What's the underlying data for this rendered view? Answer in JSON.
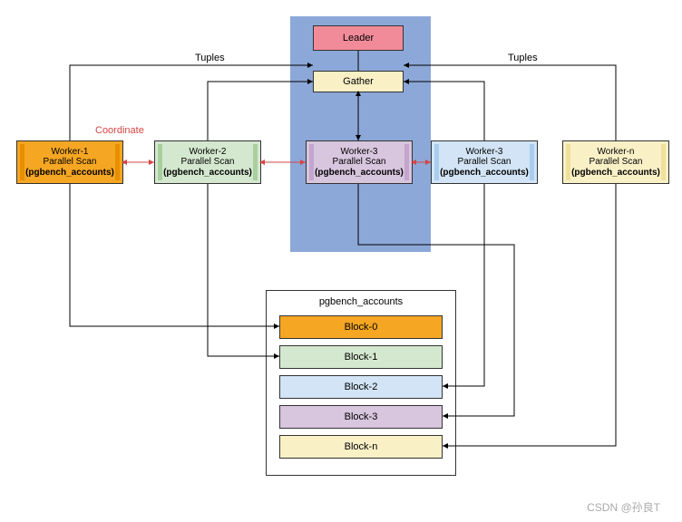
{
  "top": {
    "leader": "Leader",
    "gather": "Gather"
  },
  "labels": {
    "tuples_left": "Tuples",
    "tuples_right": "Tuples",
    "coordinate": "Coordinate"
  },
  "workers": [
    {
      "line1": "Worker-1",
      "line2": "Parallel Scan",
      "line3": "(pgbench_accounts)",
      "bg": "#f5a623",
      "bar": "#e88f00"
    },
    {
      "line1": "Worker-2",
      "line2": "Parallel Scan",
      "line3": "(pgbench_accounts)",
      "bg": "#d4e8cf",
      "bar": "#a9cf9f"
    },
    {
      "line1": "Worker-3",
      "line2": "Parallel Scan",
      "line3": "(pgbench_accounts)",
      "bg": "#d8c5de",
      "bar": "#c4a5cd"
    },
    {
      "line1": "Worker-3",
      "line2": "Parallel Scan",
      "line3": "(pgbench_accounts)",
      "bg": "#d2e4f5",
      "bar": "#a8cdee"
    },
    {
      "line1": "Worker-n",
      "line2": "Parallel Scan",
      "line3": "(pgbench_accounts)",
      "bg": "#f9f0c6",
      "bar": "#efe19a"
    }
  ],
  "blocks": {
    "title": "pgbench_accounts",
    "items": [
      {
        "label": "Block-0",
        "bg": "#f5a623"
      },
      {
        "label": "Block-1",
        "bg": "#d4e8cf"
      },
      {
        "label": "Block-2",
        "bg": "#d2e4f5"
      },
      {
        "label": "Block-3",
        "bg": "#d8c5de"
      },
      {
        "label": "Block-n",
        "bg": "#f9f0c6"
      }
    ]
  },
  "colors": {
    "leader_bg": "#f28b99",
    "gather_bg": "#f9f0c6",
    "highlight": "#8ca8d8"
  },
  "watermark": "CSDN @孙良T"
}
